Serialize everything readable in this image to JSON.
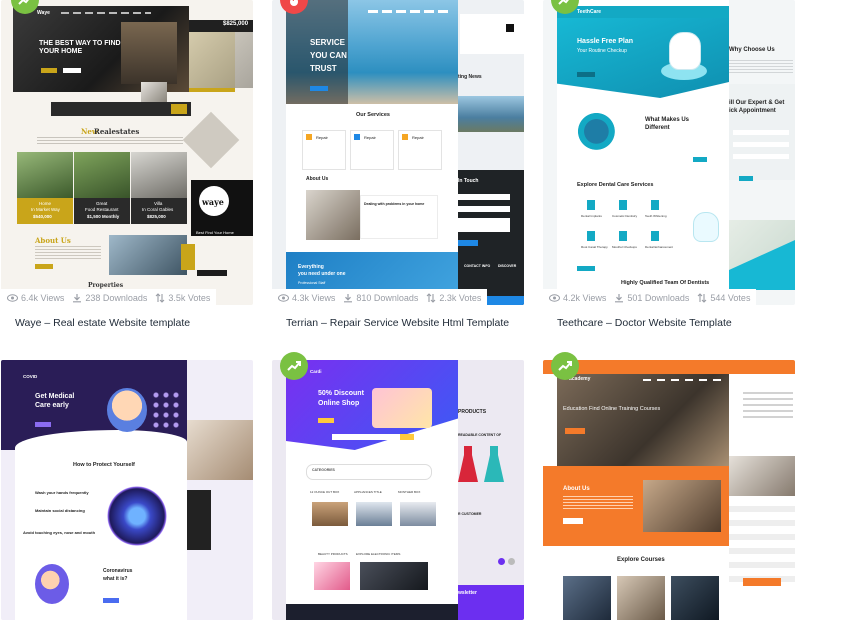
{
  "templates": [
    {
      "title": "Waye – Real estate Website template",
      "views": "6.4k Views",
      "downloads": "238 Downloads",
      "votes": "3.5k Votes",
      "badge_icon": "trending-icon",
      "preview": {
        "brand": "Waye",
        "hero_line1": "THE BEST WAY TO FIND",
        "hero_line2": "YOUR HOME",
        "price_tag": "$825,000",
        "section_heading_a": "New",
        "section_heading_b": "Realestates",
        "cards": [
          {
            "name": "Home",
            "sub": "In Market Way",
            "price": "$540,000"
          },
          {
            "name": "Great",
            "sub": "Food Restaurant",
            "price": "$1,500 Monthly"
          },
          {
            "name": "Villa",
            "sub": "In Coral Gables",
            "price": "$825,000"
          }
        ],
        "logo_word": "waye",
        "promo": "Best Find Your Home",
        "about_heading": "About Us",
        "properties_heading": "Properties"
      }
    },
    {
      "title": "Terrian – Repair Service Website Html Template",
      "views": "4.3k Views",
      "downloads": "810 Downloads",
      "votes": "2.3k Votes",
      "badge_icon": "fire-icon",
      "preview": {
        "hero_line1": "SERVICE",
        "hero_line2": "YOU CAN",
        "hero_line3": "TRUST",
        "services_heading": "Our Services",
        "service_items": [
          "Repair",
          "Repair",
          "Repair"
        ],
        "about_heading": "About Us",
        "dealing": "Dealing with problems in your home",
        "news_heading": "ting News",
        "touch_heading": "In Touch",
        "banner_line1": "Everything",
        "banner_line2": "you need under one",
        "professional": "Professional Staff",
        "contact_info": "CONTACT INFO",
        "discover": "DISCOVER"
      }
    },
    {
      "title": "Teethcare – Doctor Website Template",
      "views": "4.2k Views",
      "downloads": "501 Downloads",
      "votes": "544 Votes",
      "badge_icon": "trending-icon",
      "preview": {
        "brand": "TeethCare",
        "hero_line1": "Hassle Free Plan",
        "hero_line2": "Your Routine Checkup",
        "why_choose": "Why Choose Us",
        "expert_line1": "ill Our Expert & Get",
        "expert_line2": "ick Appointment",
        "makes_line1": "What Makes Us",
        "makes_line2": "Different",
        "explore": "Explore Dental Care Services",
        "services": [
          "Dental Implants",
          "Cosmetic Dentistry",
          "Teeth Whitening",
          "Root Canal Therapy",
          "Mouthul Checkups",
          "Dental Enhancement"
        ],
        "team": "Highly Qualified Team Of Dentists"
      }
    },
    {
      "title": "",
      "badge_icon": "",
      "preview": {
        "brand": "COVID",
        "hero_line1": "Get Medical",
        "hero_line2": "Care early",
        "protect": "How to Protect Yourself",
        "tips": [
          "Wash your hands frequently",
          "Maintain social distancing",
          "Avoid touching eyes, nose and mouth"
        ],
        "corona_line1": "Coronavirus",
        "corona_line2": "what it is?"
      }
    },
    {
      "title": "",
      "badge_icon": "trending-icon",
      "preview": {
        "brand": "Cardi",
        "hero_line1": "50% Discount",
        "hero_line2": "Online Shop",
        "products": "PRODUCTS",
        "categories": "CATEGORIES",
        "readable": "READABLE CONTENT OF",
        "cats": [
          "12 OUNCE OUT BOX",
          "APPLIANCES TITLE",
          "MONTHER BOX"
        ],
        "customers": "R CUSTOMER",
        "beauty": "BEAUTY PRODUCTS",
        "electronics": "EXPLORE ELECTRONIC ITEMS",
        "newsletter": "wsletter"
      }
    },
    {
      "title": "",
      "badge_icon": "trending-icon",
      "preview": {
        "brand": "academy",
        "hero": "Education Find Online Training Courses",
        "about": "About Us",
        "explore": "Explore Courses"
      }
    }
  ]
}
